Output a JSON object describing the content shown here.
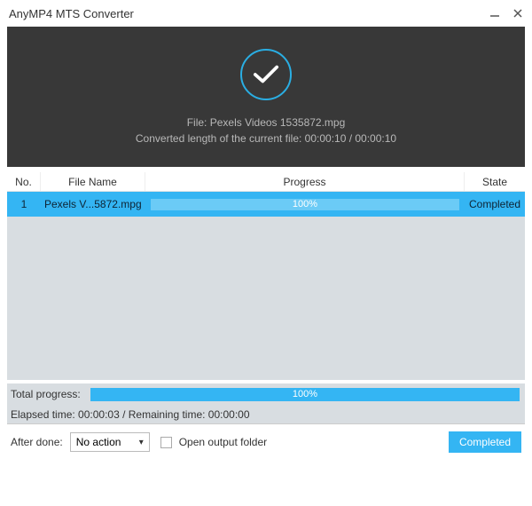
{
  "window": {
    "title": "AnyMP4 MTS Converter"
  },
  "hero": {
    "file_line": "File: Pexels Videos 1535872.mpg",
    "length_line": "Converted length of the current file: 00:00:10 / 00:00:10"
  },
  "columns": {
    "no": "No.",
    "name": "File Name",
    "progress": "Progress",
    "state": "State"
  },
  "rows": [
    {
      "no": "1",
      "name": "Pexels V...5872.mpg",
      "percent": "100%",
      "state": "Completed"
    }
  ],
  "total": {
    "label": "Total progress:",
    "percent": "100%"
  },
  "time_line": "Elapsed time: 00:00:03 / Remaining time: 00:00:00",
  "after_done": {
    "label": "After done:",
    "selected": "No action",
    "checkbox_label": "Open output folder"
  },
  "action_button": "Completed"
}
